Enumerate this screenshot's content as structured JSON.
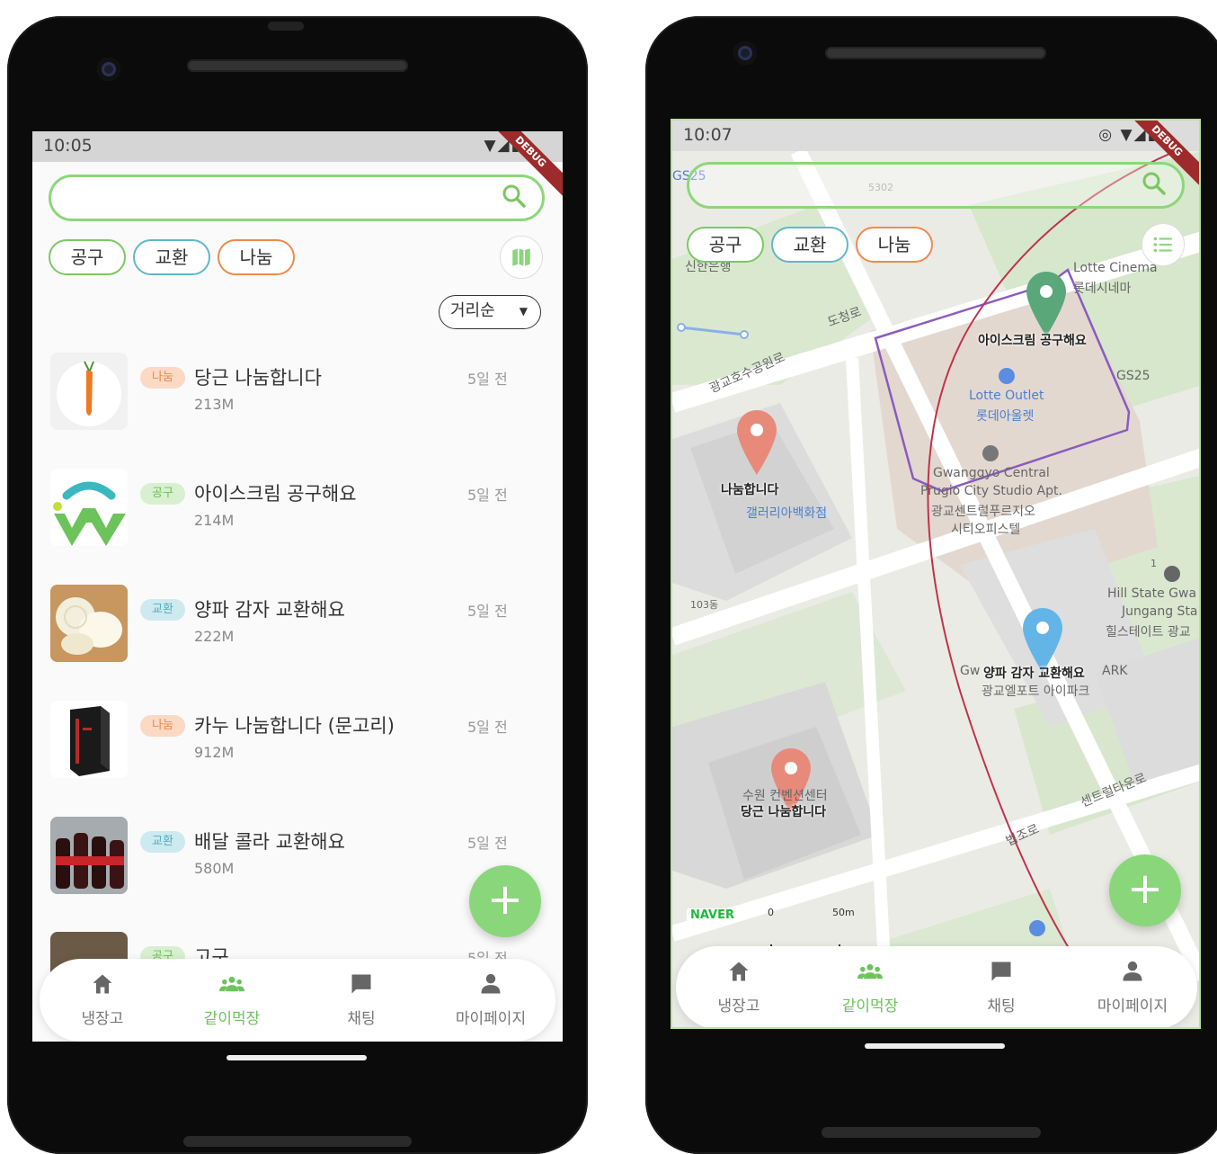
{
  "left": {
    "status_time": "10:05",
    "debug": "DEBUG",
    "search": {
      "placeholder": ""
    },
    "chips": [
      "공구",
      "교환",
      "나눔"
    ],
    "sort_label": "거리순",
    "items": [
      {
        "badge": "나눔",
        "title": "당근 나눔합니다",
        "distance": "213M",
        "ago": "5일 전"
      },
      {
        "badge": "공구",
        "title": "아이스크림 공구해요",
        "distance": "214M",
        "ago": "5일 전"
      },
      {
        "badge": "교환",
        "title": "양파 감자 교환해요",
        "distance": "222M",
        "ago": "5일 전"
      },
      {
        "badge": "나눔",
        "title": "카누 나눔합니다 (문고리)",
        "distance": "912M",
        "ago": "5일 전"
      },
      {
        "badge": "교환",
        "title": "배달 콜라 교환해요",
        "distance": "580M",
        "ago": "5일 전"
      },
      {
        "badge": "공구",
        "title": "고구",
        "distance": "",
        "ago": "5일 전"
      }
    ],
    "fab_icon": "+",
    "nav": [
      "냉장고",
      "같이먹장",
      "채팅",
      "마이페이지"
    ]
  },
  "right": {
    "status_time": "10:07",
    "debug": "DEBUG",
    "chips": [
      "공구",
      "교환",
      "나눔"
    ],
    "map": {
      "pins": [
        {
          "label": "아이스크림 공구해요",
          "color": "#5aa77a"
        },
        {
          "label": "나눔합니다",
          "color": "#e88a7a"
        },
        {
          "label": "양파 감자 교환해요",
          "color": "#63b5e8"
        },
        {
          "label": "당근 나눔합니다",
          "color": "#e88a7a"
        }
      ],
      "labels": {
        "gs25_a": "GS25",
        "gs25_b": "GS25",
        "lotte_cinema_en": "Lotte Cinema",
        "lotte_cinema_ko": "롯데시네마",
        "lotte_outlet_en": "Lotte Outlet",
        "lotte_outlet_ko": "롯데아울렛",
        "gwanggyo_1": "Gwanggyo Central",
        "gwanggyo_2": "Prugio City Studio Apt.",
        "gwanggyo_3": "광교센트럴푸르지오",
        "gwanggyo_4": "시티오피스텔",
        "gallery": "갤러리아백화점",
        "hill_1": "Hill State Gwa",
        "hill_2": "Jungang Sta",
        "hill_3": "힐스테이트 광교",
        "park_1": "Gw",
        "park_2": "ARK",
        "park_3": "광교엘포트 아이파크",
        "suwon": "수원 컨벤션센터",
        "bank": "신한은행",
        "road_1": "도청로",
        "road_2": "광교호수공원로",
        "road_3": "센트럴타운로",
        "road_4": "법조로",
        "road_5": "5302",
        "num_103": "103동",
        "num_1": "1",
        "naver": "NAVER",
        "scale_0": "0",
        "scale_50": "50m"
      }
    },
    "fab_icon": "+",
    "nav": [
      "냉장고",
      "같이먹장",
      "채팅",
      "마이페이지"
    ]
  },
  "colors": {
    "accent_green": "#8ad67a",
    "badge_orange": "#e8894a",
    "badge_blue": "#53aabd"
  }
}
